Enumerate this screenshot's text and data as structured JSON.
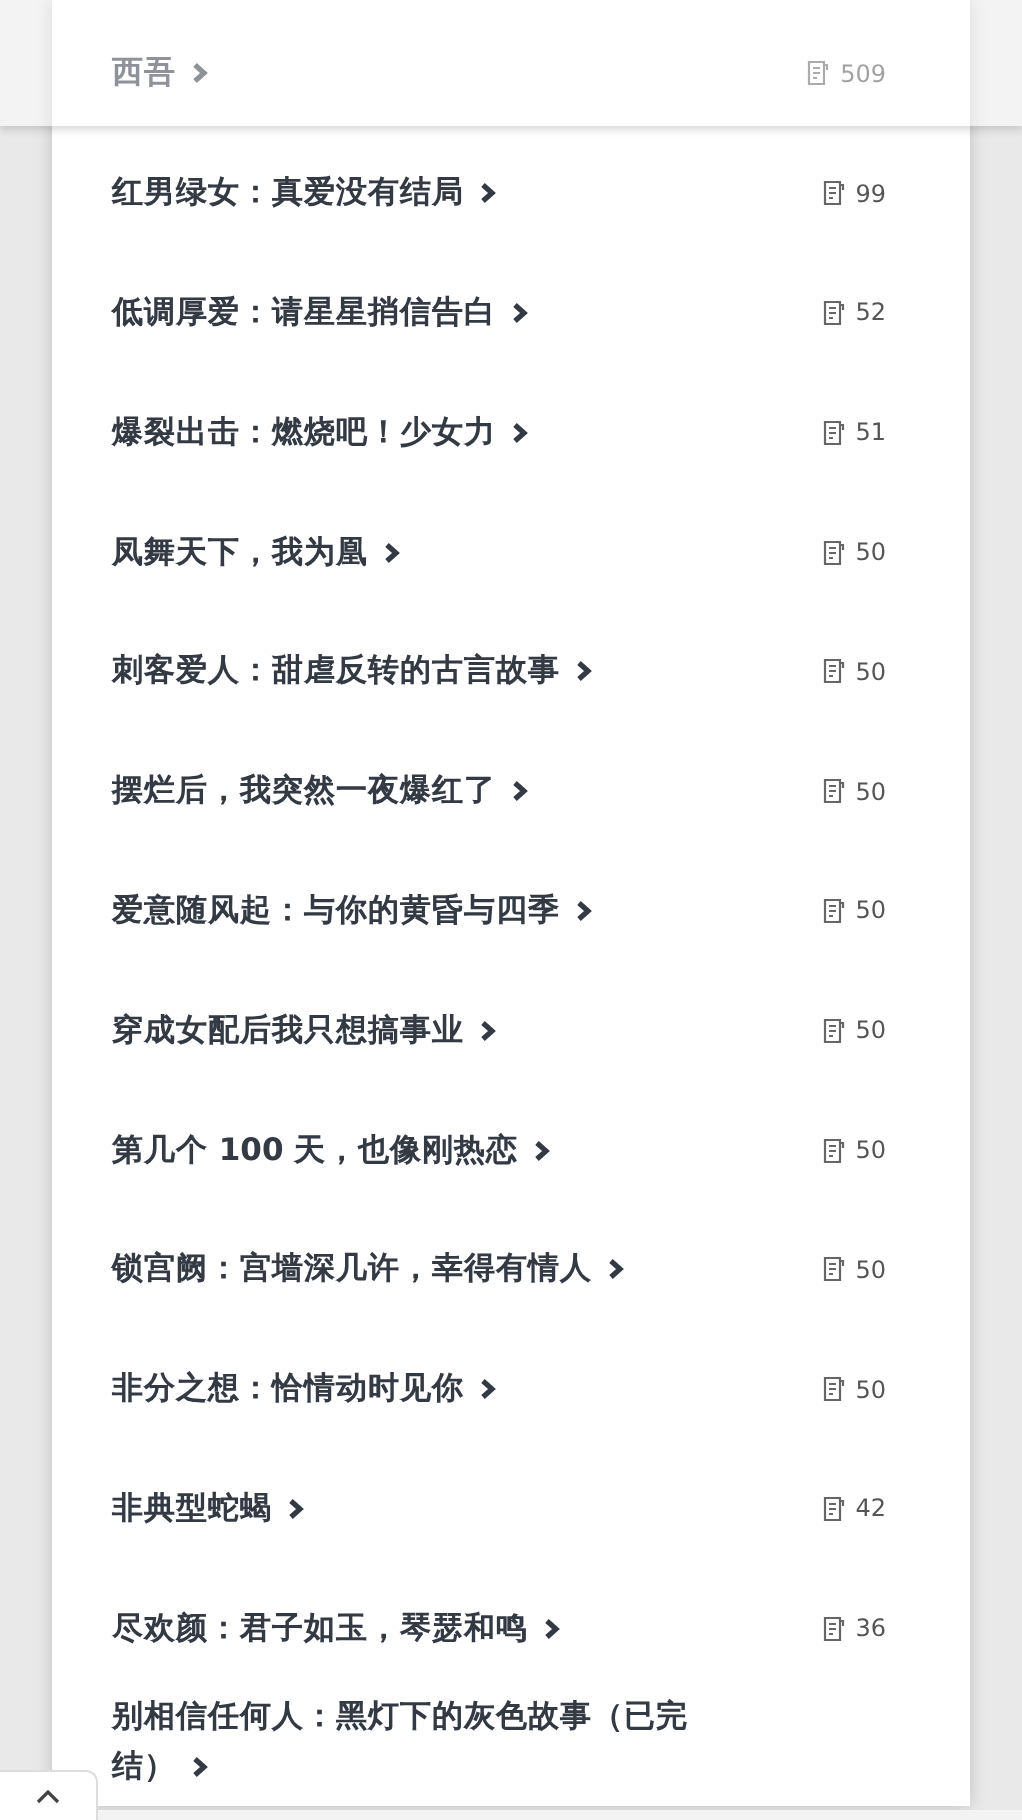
{
  "books": [
    {
      "title": "西吾",
      "count": "509"
    },
    {
      "title": "红男绿女：真爱没有结局",
      "count": "99"
    },
    {
      "title": "低调厚爱：请星星捎信告白",
      "count": "52"
    },
    {
      "title": "爆裂出击：燃烧吧！少女力",
      "count": "51"
    },
    {
      "title": "凤舞天下，我为凰",
      "count": "50"
    },
    {
      "title": "刺客爱人：甜虐反转的古言故事",
      "count": "50"
    },
    {
      "title": "摆烂后，我突然一夜爆红了",
      "count": "50"
    },
    {
      "title": "爱意随风起：与你的黄昏与四季",
      "count": "50"
    },
    {
      "title": "穿成女配后我只想搞事业",
      "count": "50"
    },
    {
      "title": "第几个 100 天，也像刚热恋",
      "count": "50"
    },
    {
      "title": "锁宫阙：宫墙深几许，幸得有情人",
      "count": "50"
    },
    {
      "title": "非分之想：恰情动时见你",
      "count": "50"
    },
    {
      "title": "非典型蛇蝎",
      "count": "42"
    },
    {
      "title": "尽欢颜：君子如玉，琴瑟和鸣",
      "count": "36"
    },
    {
      "title": "别相信任何人：黑灯下的灰色故事（已完结）"
    }
  ]
}
